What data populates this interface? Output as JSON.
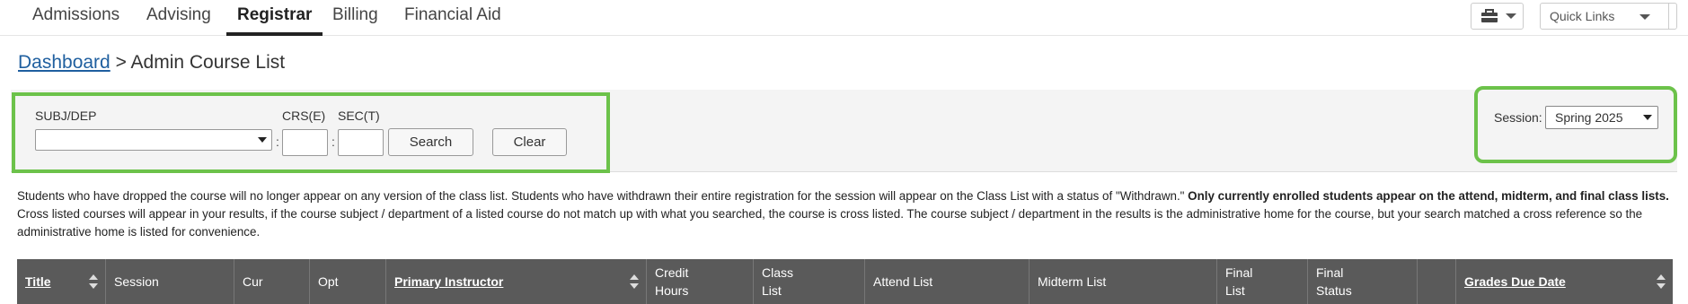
{
  "nav": {
    "tabs": [
      {
        "label": "Admissions"
      },
      {
        "label": "Advising"
      },
      {
        "label": "Registrar"
      },
      {
        "label": "Billing"
      },
      {
        "label": "Financial Aid"
      }
    ],
    "active_tab": "Registrar",
    "quick_links_label": "Quick Links"
  },
  "breadcrumb": {
    "link": "Dashboard",
    "separator": ">",
    "current": "Admin Course List"
  },
  "filters": {
    "subj_label": "SUBJ/DEP",
    "subj_value": "",
    "crs_label": "CRS(E)",
    "sec_label": "SEC(T)",
    "colon": ":",
    "search_label": "Search",
    "clear_label": "Clear",
    "session_label": "Session:",
    "session_value": "Spring 2025"
  },
  "notice": {
    "text1": "Students who have dropped the course will no longer appear on any version of the class list. Students who have withdrawn their entire registration for the session will appear on the Class List with a status of \"Withdrawn.\" ",
    "bold": "Only currently enrolled students appear on the attend, midterm, and final class lists.",
    "text2": " Cross listed courses will appear in your results, if the course subject / department of a listed course do not match up with what you searched, the course is cross listed. The course subject / department in the results is the administrative home for the course, but your search matched a cross reference so the administrative home is listed for convenience."
  },
  "table": {
    "columns": [
      {
        "label": "Title",
        "sortable": true
      },
      {
        "label": "Session",
        "sortable": false
      },
      {
        "label": "Cur",
        "sortable": false
      },
      {
        "label": "Opt",
        "sortable": false
      },
      {
        "label": "Primary Instructor",
        "sortable": true
      },
      {
        "label": "Credit Hours",
        "sortable": false
      },
      {
        "label": "Class List",
        "sortable": false
      },
      {
        "label": "Attend List",
        "sortable": false
      },
      {
        "label": "Midterm List",
        "sortable": false
      },
      {
        "label": "Final List",
        "sortable": false
      },
      {
        "label": "Final Status",
        "sortable": false
      },
      {
        "label": "",
        "sortable": false
      },
      {
        "label": "Grades Due Date",
        "sortable": true
      }
    ]
  },
  "colors": {
    "highlight": "#6cc24a",
    "table_header": "#5a5a5a",
    "link": "#1f5f9f"
  }
}
